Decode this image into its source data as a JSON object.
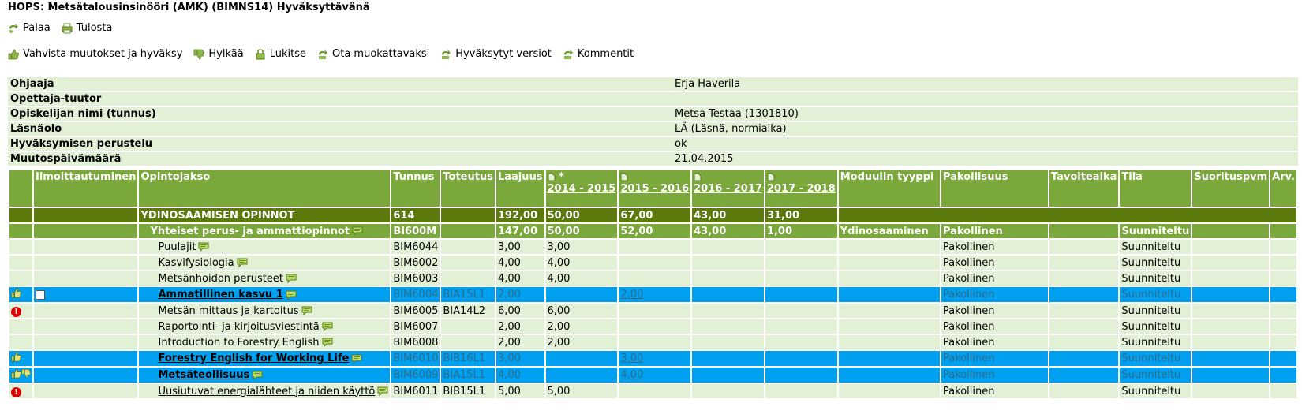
{
  "page": {
    "title": "HOPS: Metsätalousinsinööri (AMK) (BIMNS14) Hyväksyttävänä"
  },
  "nav": {
    "back": "Palaa",
    "print": "Tulosta"
  },
  "actions": {
    "confirm": "Vahvista muutokset ja hyväksy",
    "reject": "Hylkää",
    "lock": "Lukitse",
    "edit": "Ota muokattavaksi",
    "versions": "Hyväksytyt versiot",
    "comments": "Kommentit"
  },
  "info": [
    {
      "label": "Ohjaaja",
      "value": "Erja Haverila"
    },
    {
      "label": "Opettaja-tuutor",
      "value": ""
    },
    {
      "label": "Opiskelijan nimi (tunnus)",
      "value": "Metsa Testaa (1301810)"
    },
    {
      "label": "Läsnäolo",
      "value": "LÄ (Läsnä, normiaika)"
    },
    {
      "label": "Hyväksymisen perustelu",
      "value": "ok"
    },
    {
      "label": "Muutospäivämäärä",
      "value": "21.04.2015"
    }
  ],
  "table": {
    "headers": {
      "signup": "Ilmoittautuminen",
      "course": "Opintojakso",
      "code": "Tunnus",
      "impl": "Toteutus",
      "scope": "Laajuus",
      "y1_star": "*",
      "y1": "2014 - 2015",
      "y2": "2015 - 2016",
      "y3": "2016 - 2017",
      "y4": "2017 - 2018",
      "module": "Moduulin tyyppi",
      "mandatory": "Pakollisuus",
      "target": "Tavoiteaika",
      "status": "Tila",
      "done": "Suorituspvm",
      "grade": "Arv."
    },
    "group": {
      "name": "YDINOSAAMISEN OPINNOT",
      "code": "614",
      "scope": "192,00",
      "y1": "50,00",
      "y2": "67,00",
      "y3": "43,00",
      "y4": "31,00"
    },
    "sub": {
      "name": "Yhteiset perus- ja ammattiopinnot",
      "code": "BI600M",
      "scope": "147,00",
      "y1": "50,00",
      "y2": "52,00",
      "y3": "43,00",
      "y4": "1,00",
      "module": "Ydinosaaminen",
      "mandatory": "Pakollinen",
      "status": "Suunniteltu"
    },
    "rows": [
      {
        "name": "Puulajit",
        "code": "BIM6044",
        "impl": "",
        "scope": "3,00",
        "y1": "3,00",
        "y2": "",
        "mandatory": "Pakollinen",
        "status": "Suunniteltu"
      },
      {
        "name": "Kasvifysiologia",
        "code": "BIM6002",
        "impl": "",
        "scope": "4,00",
        "y1": "4,00",
        "y2": "",
        "mandatory": "Pakollinen",
        "status": "Suunniteltu"
      },
      {
        "name": "Metsänhoidon perusteet",
        "code": "BIM6003",
        "impl": "",
        "scope": "4,00",
        "y1": "4,00",
        "y2": "",
        "mandatory": "Pakollinen",
        "status": "Suunniteltu"
      },
      {
        "name": "Ammatillinen kasvu 1",
        "code": "BIM6004",
        "impl": "BIA15L1",
        "scope": "2,00",
        "y1": "",
        "y2": "2,00",
        "mandatory": "Pakollinen",
        "status": "Suunniteltu"
      },
      {
        "name": "Metsän mittaus ja kartoitus",
        "code": "BIM6005",
        "impl": "BIA14L2",
        "scope": "6,00",
        "y1": "6,00",
        "y2": "",
        "mandatory": "Pakollinen",
        "status": "Suunniteltu"
      },
      {
        "name": "Raportointi- ja kirjoitusviestintä",
        "code": "BIM6007",
        "impl": "",
        "scope": "2,00",
        "y1": "2,00",
        "y2": "",
        "mandatory": "Pakollinen",
        "status": "Suunniteltu"
      },
      {
        "name": "Introduction to Forestry English",
        "code": "BIM6008",
        "impl": "",
        "scope": "2,00",
        "y1": "2,00",
        "y2": "",
        "mandatory": "Pakollinen",
        "status": "Suunniteltu"
      },
      {
        "name": "Forestry English for Working Life",
        "code": "BIM6010",
        "impl": "BIB16L1",
        "scope": "3,00",
        "y1": "",
        "y2": "3,00",
        "mandatory": "Pakollinen",
        "status": "Suunniteltu"
      },
      {
        "name": "Metsäteollisuus",
        "code": "BIM6009",
        "impl": "BIA15L1",
        "scope": "4,00",
        "y1": "",
        "y2": "4,00",
        "mandatory": "Pakollinen",
        "status": "Suunniteltu"
      },
      {
        "name": "Uusiutuvat energialähteet ja niiden käyttö",
        "code": "BIM6011",
        "impl": "BIB15L1",
        "scope": "5,00",
        "y1": "5,00",
        "y2": "",
        "mandatory": "Pakollinen",
        "status": "Suunniteltu"
      }
    ]
  }
}
